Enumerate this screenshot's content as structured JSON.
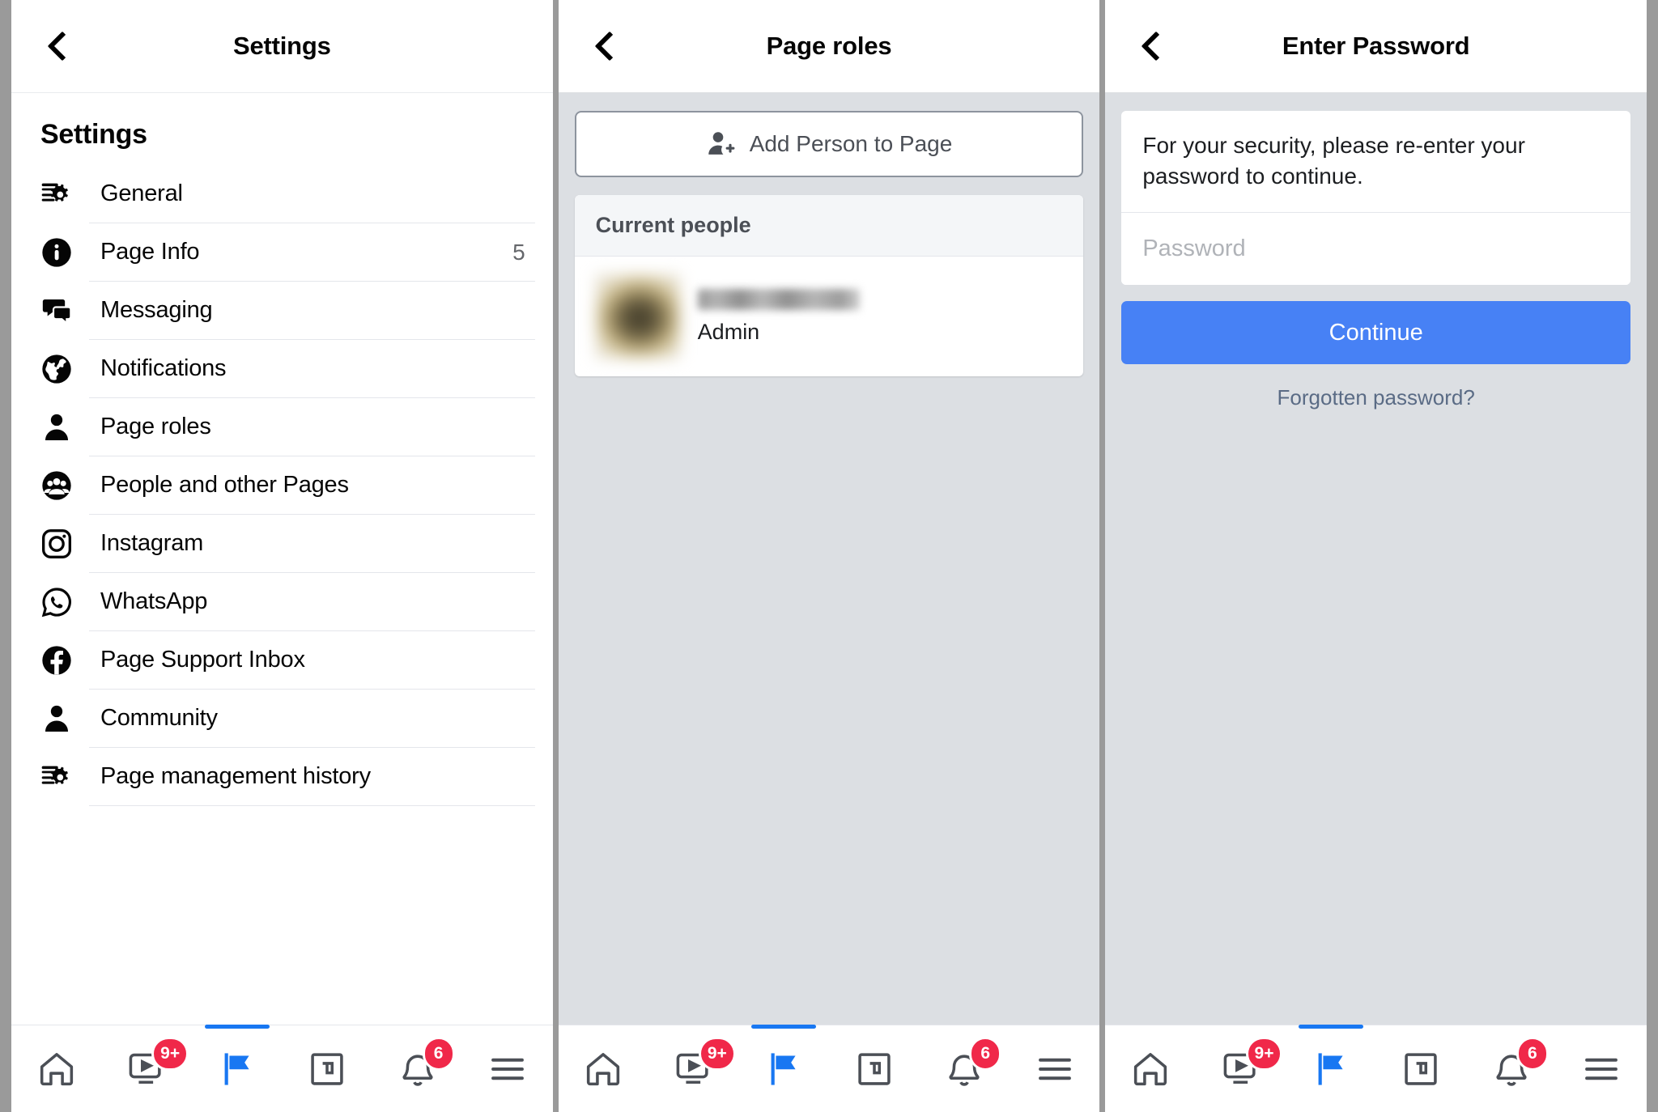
{
  "screens": [
    {
      "id": "settings",
      "topbar": {
        "title": "Settings",
        "back_icon": "chevron-left-icon"
      },
      "page_heading": "Settings",
      "items": [
        {
          "label": "General",
          "icon": "sliders-gear-icon",
          "count": ""
        },
        {
          "label": "Page Info",
          "icon": "info-circle-icon",
          "count": "5"
        },
        {
          "label": "Messaging",
          "icon": "chat-bubbles-icon",
          "count": ""
        },
        {
          "label": "Notifications",
          "icon": "globe-icon",
          "count": ""
        },
        {
          "label": "Page roles",
          "icon": "person-icon",
          "count": ""
        },
        {
          "label": "People and other Pages",
          "icon": "people-group-icon",
          "count": ""
        },
        {
          "label": "Instagram",
          "icon": "instagram-icon",
          "count": ""
        },
        {
          "label": "WhatsApp",
          "icon": "whatsapp-icon",
          "count": ""
        },
        {
          "label": "Page Support Inbox",
          "icon": "facebook-icon",
          "count": ""
        },
        {
          "label": "Community",
          "icon": "person-icon",
          "count": ""
        },
        {
          "label": "Page management history",
          "icon": "sliders-gear-icon",
          "count": ""
        }
      ]
    },
    {
      "id": "page-roles",
      "topbar": {
        "title": "Page roles",
        "back_icon": "chevron-left-icon"
      },
      "add_person": {
        "label": "Add Person to Page",
        "icon": "person-add-icon"
      },
      "current_people": {
        "header": "Current people",
        "rows": [
          {
            "name": "",
            "role": "Admin",
            "avatar": "blurred-profile-photo"
          }
        ]
      }
    },
    {
      "id": "enter-password",
      "topbar": {
        "title": "Enter Password",
        "back_icon": "chevron-left-icon"
      },
      "security_text": "For your security, please re-enter your password to continue.",
      "password_field": {
        "value": "",
        "placeholder": "Password"
      },
      "continue_label": "Continue",
      "forgot_label": "Forgotten password?"
    }
  ],
  "tabbar": {
    "tabs": [
      {
        "name": "home",
        "icon": "home-icon",
        "badge": "",
        "active": false
      },
      {
        "name": "watch",
        "icon": "video-play-icon",
        "badge": "9+",
        "active": false
      },
      {
        "name": "pages",
        "icon": "flag-icon",
        "badge": "",
        "active": true
      },
      {
        "name": "marketplace",
        "icon": "storefront-icon",
        "badge": "",
        "active": false
      },
      {
        "name": "notifications",
        "icon": "bell-icon",
        "badge": "6",
        "active": false
      },
      {
        "name": "menu",
        "icon": "hamburger-icon",
        "badge": "",
        "active": false
      }
    ]
  },
  "colors": {
    "accent_blue": "#1877f2",
    "button_blue": "#4781f5",
    "badge_red": "#f02849",
    "page_grey": "#dcdfe3",
    "frame_grey": "#9a9a9a"
  }
}
